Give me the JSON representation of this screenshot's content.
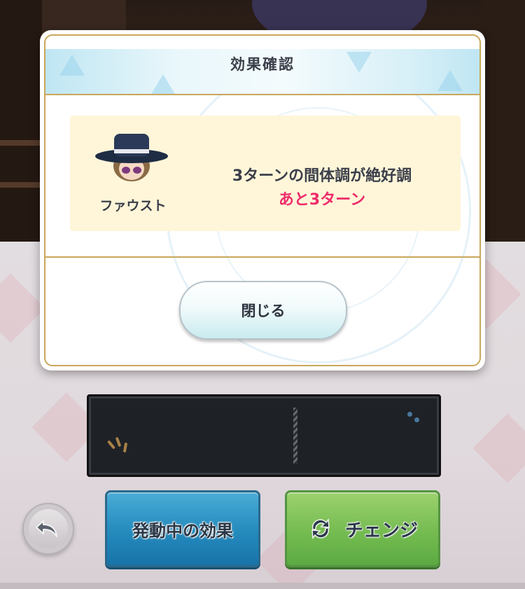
{
  "modal": {
    "title": "効果確認",
    "character_name": "ファウスト",
    "effect_description": "3ターンの間体調が絶好調",
    "effect_remaining": "あと3ターン",
    "close_label": "閉じる"
  },
  "bottom_bar": {
    "back_icon": "back-arrow-icon",
    "active_effects_label": "発動中の効果",
    "change_label": "チェンジ",
    "change_icon": "swap-arrows-icon"
  },
  "colors": {
    "accent_gold": "#c9a75a",
    "remaining_pink": "#ee2b6b",
    "card_cream": "#fff6d9",
    "blue_button": "#2692c7",
    "green_button": "#7bc655"
  }
}
